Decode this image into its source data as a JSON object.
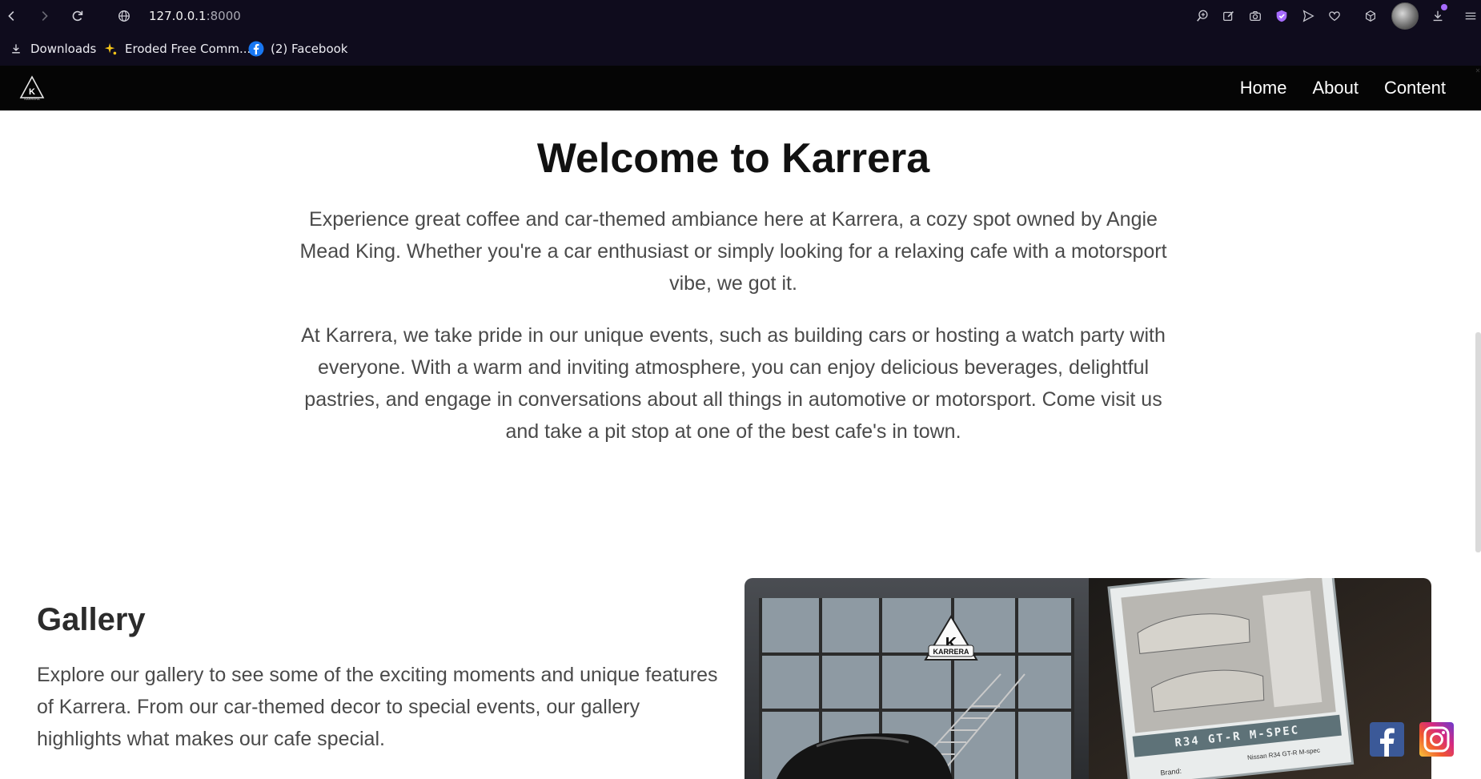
{
  "browser": {
    "url_host": "127.0.0.1",
    "url_port": ":8000",
    "bookmarks": [
      {
        "label": "Downloads",
        "icon": "download-icon"
      },
      {
        "label": "Eroded Free Comm...",
        "icon": "sparkle-icon"
      },
      {
        "label": "(2) Facebook",
        "icon": "facebook-icon"
      }
    ],
    "accent": "#a66bff"
  },
  "site": {
    "nav": [
      "Home",
      "About",
      "Content"
    ],
    "logo_text": "KARRERA"
  },
  "hero": {
    "title": "Welcome to Karrera",
    "paragraph1": "Experience great coffee and car-themed ambiance here at Karrera, a cozy spot owned by Angie Mead King. Whether you're a car enthusiast or simply looking for a relaxing cafe with a motorsport vibe, we got it.",
    "paragraph2": "At Karrera, we take pride in our unique events, such as building cars or hosting a watch party with everyone. With a warm and inviting atmosphere, you can enjoy delicious beverages, delightful pastries, and engage in conversations about all things in automotive or motorsport. Come visit us and take a pit stop at one of the best cafe's in town."
  },
  "gallery": {
    "title": "Gallery",
    "text": "Explore our gallery to see some of the exciting moments and unique features of Karrera. From our car-themed decor to special events, our gallery highlights what makes our cafe special.",
    "image_sign_text": "K",
    "image_sign_sub": "KARRERA",
    "image_placard": "R34 GT-R M-SPEC",
    "image_placard_brand": "Brand:",
    "image_placard_value": "Nissan R34 GT-R M-spec"
  },
  "social": [
    "facebook-icon",
    "instagram-icon"
  ]
}
